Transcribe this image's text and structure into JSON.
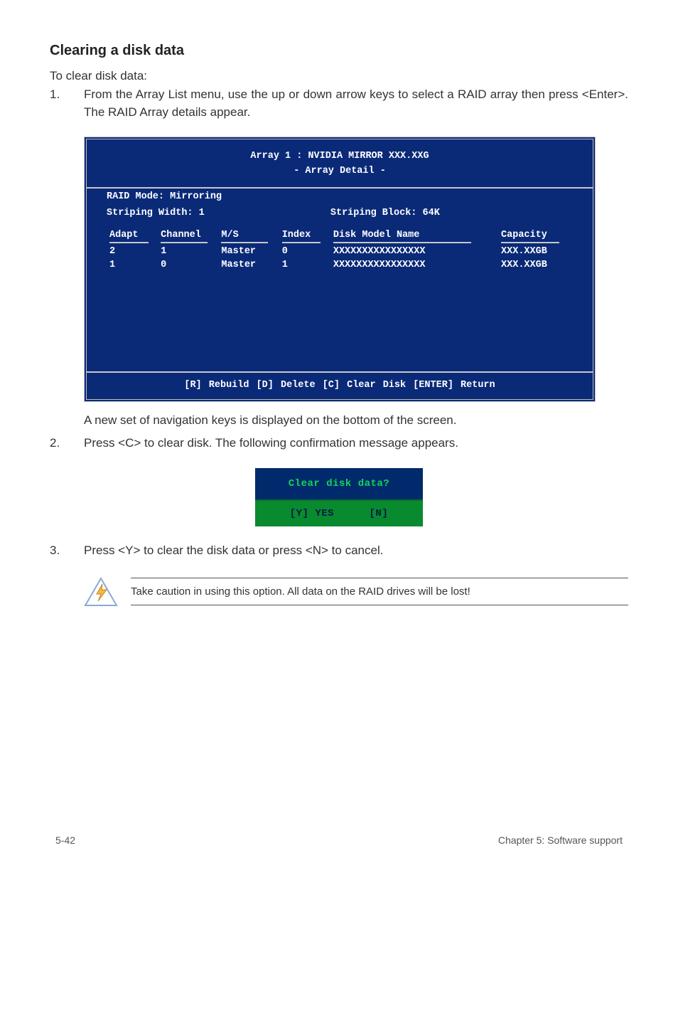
{
  "heading": "Clearing a disk data",
  "intro": "To clear disk data:",
  "steps": {
    "s1": {
      "num": "1.",
      "text": "From the Array List menu, use the up or down arrow keys to select a RAID array then press <Enter>. The RAID Array details appear."
    },
    "s1b": "A new set of  navigation keys is displayed on the bottom of the screen.",
    "s2": {
      "num": "2.",
      "text": "Press <C> to clear disk. The following confirmation message appears."
    },
    "s3": {
      "num": "3.",
      "text": "Press <Y> to clear the disk data or press <N> to cancel."
    }
  },
  "bios": {
    "title_line1": "Array 1 : NVIDIA MIRROR  XXX.XXG",
    "title_line2": "- Array Detail -",
    "mode_line": "RAID Mode: Mirroring",
    "striping_width": "Striping Width: 1",
    "striping_block": "Striping Block: 64K",
    "headers": {
      "adapt": "Adapt",
      "channel": "Channel",
      "ms": "M/S",
      "index": "Index",
      "model": "Disk Model Name",
      "capacity": "Capacity"
    },
    "rows": [
      {
        "adapt": "2",
        "channel": "1",
        "ms": "Master",
        "index": "0",
        "model": "XXXXXXXXXXXXXXXX",
        "capacity": "XXX.XXGB"
      },
      {
        "adapt": "1",
        "channel": "0",
        "ms": "Master",
        "index": "1",
        "model": "XXXXXXXXXXXXXXXX",
        "capacity": "XXX.XXGB"
      }
    ],
    "footer": "[R] Rebuild  [D] Delete  [C] Clear Disk  [ENTER] Return"
  },
  "confirm": {
    "question": "Clear disk data?",
    "yes": "[Y] YES",
    "no": "[N]"
  },
  "note": "Take caution in using this option. All data on the RAID drives will be lost!",
  "footer": {
    "left": "5-42",
    "right": "Chapter 5: Software support"
  }
}
